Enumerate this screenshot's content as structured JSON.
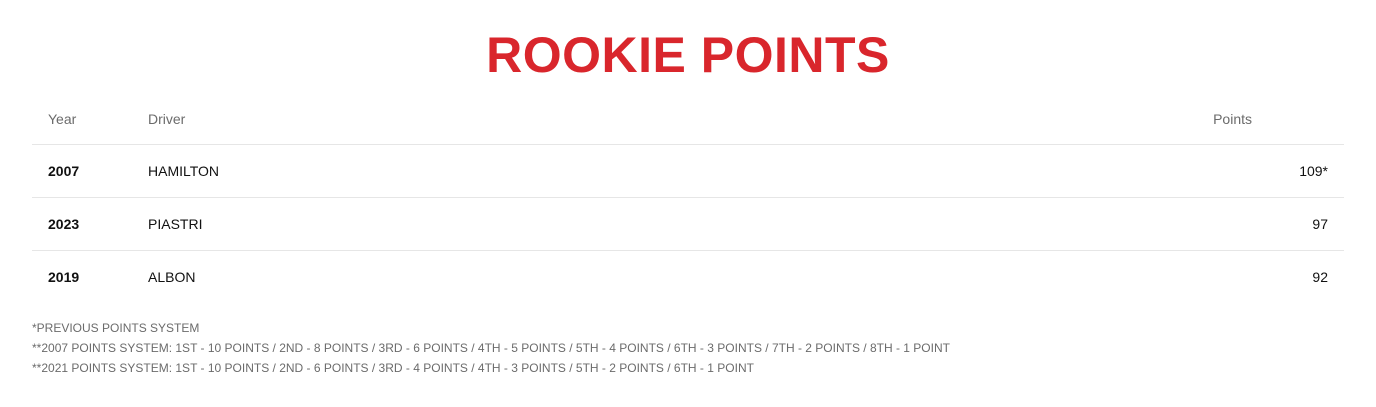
{
  "page": {
    "title": "ROOKIE POINTS"
  },
  "colors": {
    "accent": "#d9262c",
    "header_text": "#6b6b6b",
    "divider": "#e6e6e6"
  },
  "table": {
    "headers": {
      "year": "Year",
      "driver": "Driver",
      "points": "Points"
    },
    "rows": [
      {
        "year": "2007",
        "driver": "HAMILTON",
        "points": "109*"
      },
      {
        "year": "2023",
        "driver": "PIASTRI",
        "points": "97"
      },
      {
        "year": "2019",
        "driver": "ALBON",
        "points": "92"
      }
    ]
  },
  "notes": [
    "*PREVIOUS POINTS SYSTEM",
    "**2007 POINTS SYSTEM: 1ST - 10 POINTS / 2ND - 8 POINTS / 3RD - 6 POINTS / 4TH - 5 POINTS / 5TH - 4 POINTS / 6TH - 3 POINTS / 7TH - 2 POINTS / 8TH - 1 POINT",
    "**2021 POINTS SYSTEM: 1ST - 10 POINTS / 2ND - 6 POINTS / 3RD - 4 POINTS / 4TH - 3 POINTS / 5TH - 2 POINTS / 6TH - 1 POINT"
  ]
}
